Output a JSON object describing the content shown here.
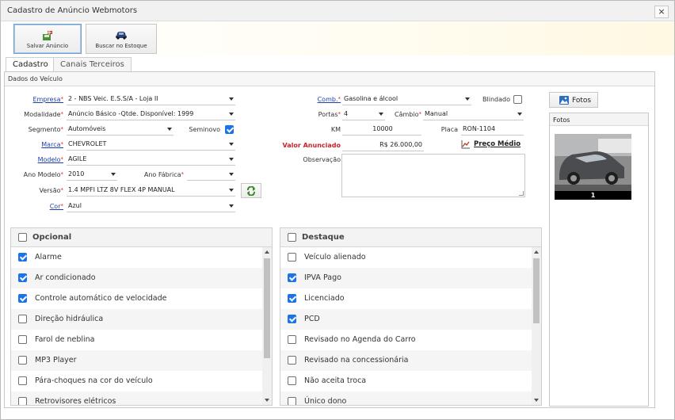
{
  "window": {
    "title": "Cadastro de Anúncio Webmotors",
    "close": "×"
  },
  "toolbar": {
    "save_label": "Salvar Anúncio",
    "search_label": "Buscar no Estoque"
  },
  "tabs": [
    {
      "label": "Cadastro",
      "selected": true
    },
    {
      "label": "Canais Terceiros",
      "selected": false
    }
  ],
  "panel": {
    "title": "Dados do Veículo"
  },
  "form": {
    "empresa": {
      "label": "Empresa",
      "value": "2 - NBS Veic. E.S.S/A - Loja II"
    },
    "modalidade": {
      "label": "Modalidade",
      "value": "Anúncio Básico -Qtde. Disponível: 1999"
    },
    "segmento": {
      "label": "Segmento",
      "value": "Automóveis"
    },
    "seminovo": {
      "label": "Seminovo",
      "checked": true
    },
    "marca": {
      "label": "Marca",
      "value": "CHEVROLET"
    },
    "modelo": {
      "label": "Modelo",
      "value": "AGILE"
    },
    "ano_modelo": {
      "label": "Ano Modelo",
      "value": "2010"
    },
    "ano_fabrica": {
      "label": "Ano Fábrica",
      "value": ""
    },
    "versao": {
      "label": "Versão",
      "value": "1.4 MPFI LTZ 8V FLEX 4P MANUAL"
    },
    "cor": {
      "label": "Cor",
      "value": "Azul"
    },
    "comb": {
      "label": "Comb.",
      "value": "Gasolina e álcool"
    },
    "blindado": {
      "label": "Blindado",
      "checked": false
    },
    "portas": {
      "label": "Portas",
      "value": "4"
    },
    "cambio": {
      "label": "Câmbio",
      "value": "Manual"
    },
    "km": {
      "label": "KM",
      "value": "10000"
    },
    "placa": {
      "label": "Placa",
      "value": "RON-1104"
    },
    "valor": {
      "label": "Valor Anunciado",
      "value": "R$ 26.000,00"
    },
    "preco_medio": {
      "label": "Preço Médio"
    },
    "observacao": {
      "label": "Observação",
      "value": ""
    },
    "required_mark": "*"
  },
  "fotos": {
    "button_label": "Fotos",
    "panel_title": "Fotos",
    "thumb_number": "1"
  },
  "opcional": {
    "title": "Opcional",
    "items": [
      {
        "label": "Alarme",
        "checked": true
      },
      {
        "label": "Ar condicionado",
        "checked": true
      },
      {
        "label": "Controle automático de velocidade",
        "checked": true
      },
      {
        "label": "Direção hidráulica",
        "checked": false
      },
      {
        "label": "Farol de neblina",
        "checked": false
      },
      {
        "label": "MP3 Player",
        "checked": false
      },
      {
        "label": "Pára-choques na cor do veículo",
        "checked": false
      },
      {
        "label": "Retrovisores elétricos",
        "checked": false
      }
    ]
  },
  "destaque": {
    "title": "Destaque",
    "items": [
      {
        "label": "Veículo alienado",
        "checked": false
      },
      {
        "label": "IPVA Pago",
        "checked": true
      },
      {
        "label": "Licenciado",
        "checked": true
      },
      {
        "label": "PCD",
        "checked": true
      },
      {
        "label": "Revisado no Agenda do Carro",
        "checked": false
      },
      {
        "label": "Revisado na concessionária",
        "checked": false
      },
      {
        "label": "Não aceita troca",
        "checked": false
      },
      {
        "label": "Único dono",
        "checked": false
      }
    ]
  }
}
